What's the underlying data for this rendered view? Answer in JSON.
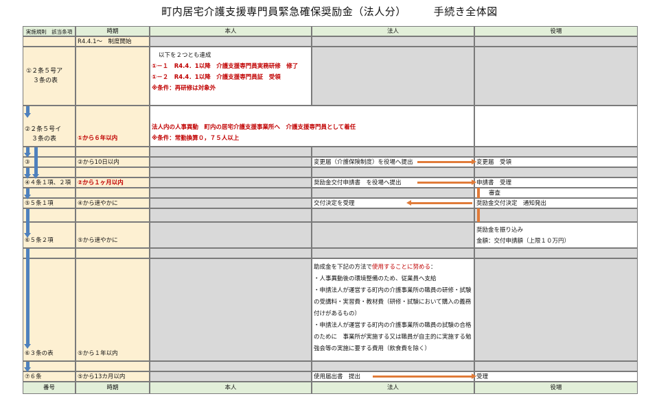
{
  "title": {
    "main": "町内居宅介護支援専門員緊急確保奨励金（法人分）",
    "sub": "手続き全体図"
  },
  "header": {
    "col1": "実施規則　該当条項",
    "col2": "時期",
    "col3": "本人",
    "col4": "法人",
    "col5": "役場"
  },
  "footer": {
    "col1": "番号",
    "col2": "時期",
    "col3": "本人",
    "col4": "法人",
    "col5": "役場"
  },
  "rows": {
    "start": {
      "col2": "R4.4.1～　制度開始"
    },
    "r1": {
      "col1a": "①２条５号ア",
      "col1b": "３条の表",
      "col3_intro": "以下を２つとも達成",
      "col3_line1": "①－１　R4.4．1以降　介護支援専門員実務研修　修了",
      "col3_line2": "①－２　R4.4．1以降　介護支援専門員証　受領",
      "col3_line3": "※条件：再研修は対象外"
    },
    "r2": {
      "col1a": "②２条５号イ",
      "col1b": "３条の表",
      "col2": "①から６年以内",
      "col3_line1": "法人内の人事異動　町内の居宅介護支援事業所へ　介護支援専門員として着任",
      "col3_line2": "※条件：常勤換算０，７５人以上"
    },
    "r3": {
      "col1": "③",
      "col2": "②から10日以内",
      "col4": "変更届（介護保険制度）を役場へ提出",
      "col5": "変更届　受領"
    },
    "r4": {
      "col1": "④４条１項、２項",
      "col2": "②から１ヶ月以内",
      "col4": "奨励金交付申請書　を役場へ提出",
      "col5a": "申請書　受理",
      "col5b": "審査"
    },
    "r5": {
      "col1": "⑤５条１項",
      "col2": "④から速やかに",
      "col4": "交付決定を受理",
      "col5": "奨励金交付決定　通知発出"
    },
    "r6": {
      "col1": "⑥５条２項",
      "col2": "⑤から速やかに",
      "col5a": "奨励金を振り込み",
      "col5b": "金額：交付申請額（上限１０万円）"
    },
    "r7": {
      "col1": "⑥３条の表",
      "col2": "⑤から１年以内",
      "col4_intro_pre": "助成金を下記の方法で",
      "col4_intro_red": "使用することに努める",
      "col4_intro_post": "：",
      "col4_b1": "・人事異動後の環境整備のため、従業員へ支給",
      "col4_b2": "・申請法人が運営する町内の介護事業所の職員の研修・試験の受講料・実習費・教材費（研修・試験において購入の義務付けがあるもの）",
      "col4_b3": "・申請法人が運営する町内の介護事業所の職員の試験の合格のために　事業所が実施する又は職員が自主的に実施する勉強会等の実施に要する費用（飲食費を除く）"
    },
    "r8": {
      "col1": "⑦６条",
      "col2": "⑤から13カ月以内",
      "col4": "使用届出書　提出",
      "col5": "受理"
    }
  },
  "colors": {
    "yellow": "#fdf0d2",
    "gray": "#d9d9d9",
    "header": "#e2efd9",
    "red": "#c00000",
    "orange": "#e07b39",
    "blue": "#4f81bd"
  }
}
